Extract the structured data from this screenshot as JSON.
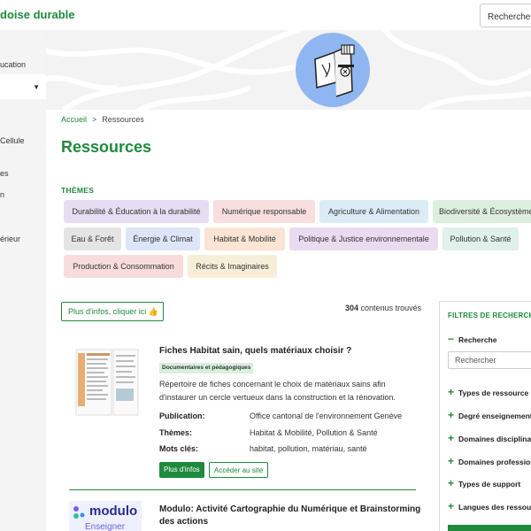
{
  "header": {
    "site_title": "doise durable",
    "search_label": "Recherche"
  },
  "sidebar": {
    "items": [
      {
        "label": "ucation"
      },
      {
        "label": "Cellule"
      },
      {
        "label": "es"
      },
      {
        "label": "n"
      },
      {
        "label": "érieur"
      }
    ]
  },
  "breadcrumb": {
    "home": "Accueil",
    "separator": ">",
    "current": "Ressources"
  },
  "page": {
    "title": "Ressources",
    "themes_label": "THÈMES"
  },
  "themes": [
    {
      "label": "Durabilité & Éducation à la durabilité",
      "color": "#e6ddf3"
    },
    {
      "label": "Numérique responsable",
      "color": "#f8dede"
    },
    {
      "label": "Agriculture & Alimentation",
      "color": "#dcecf7"
    },
    {
      "label": "Biodiversité & Écosystèmes",
      "color": "#dcefdc"
    },
    {
      "label": "Eau & Forêt",
      "color": "#e4e4e4"
    },
    {
      "label": "Énergie & Climat",
      "color": "#dde6f8"
    },
    {
      "label": "Habitat & Mobilité",
      "color": "#fbe4d3"
    },
    {
      "label": "Politique & Justice environnementale",
      "color": "#eadcf0"
    },
    {
      "label": "Pollution & Santé",
      "color": "#e0f0ea"
    },
    {
      "label": "Production & Consommation",
      "color": "#f8dcdc"
    },
    {
      "label": "Récits & Imaginaires",
      "color": "#f7eed9"
    }
  ],
  "results_bar": {
    "more_info_button": "Plus d'infos, cliquer ici",
    "count": "304",
    "count_suffix": "contenus trouvés"
  },
  "results": [
    {
      "title": "Fiches Habitat sain, quels matériaux choisir ?",
      "badge": "Documentaires et pédagogiques",
      "description": "Répertoire de fiches concernant le choix de matériaux sains afin d'instaurer un cercle vertueux dans la construction et la rénovation.",
      "meta": [
        {
          "key": "Publication:",
          "value": "Office cantonal de l'environnement Genève"
        },
        {
          "key": "Thèmes:",
          "value": "Habitat & Mobilité, Pollution & Santé"
        },
        {
          "key": "Mots clés:",
          "value": "habitat, pollution, matériau, santé"
        }
      ],
      "primary_button": "Plus d'infos",
      "secondary_button": "Accéder au site"
    },
    {
      "title": "Modulo: Activité Cartographie du Numérique et Brainstorming des actions",
      "logo_word": "modulo",
      "logo_sub": "Enseigner"
    }
  ],
  "filters": {
    "title": "FILTRES DE RECHERCHE",
    "search_section": "Recherche",
    "search_placeholder": "Rechercher",
    "groups": [
      {
        "label": "Types de ressource"
      },
      {
        "label": "Degré enseignement"
      },
      {
        "label": "Domaines disciplinaires"
      },
      {
        "label": "Domaines professionnels"
      },
      {
        "label": "Types de support"
      },
      {
        "label": "Langues des ressources"
      }
    ]
  },
  "colors": {
    "brand_green": "#1f8a3c"
  }
}
